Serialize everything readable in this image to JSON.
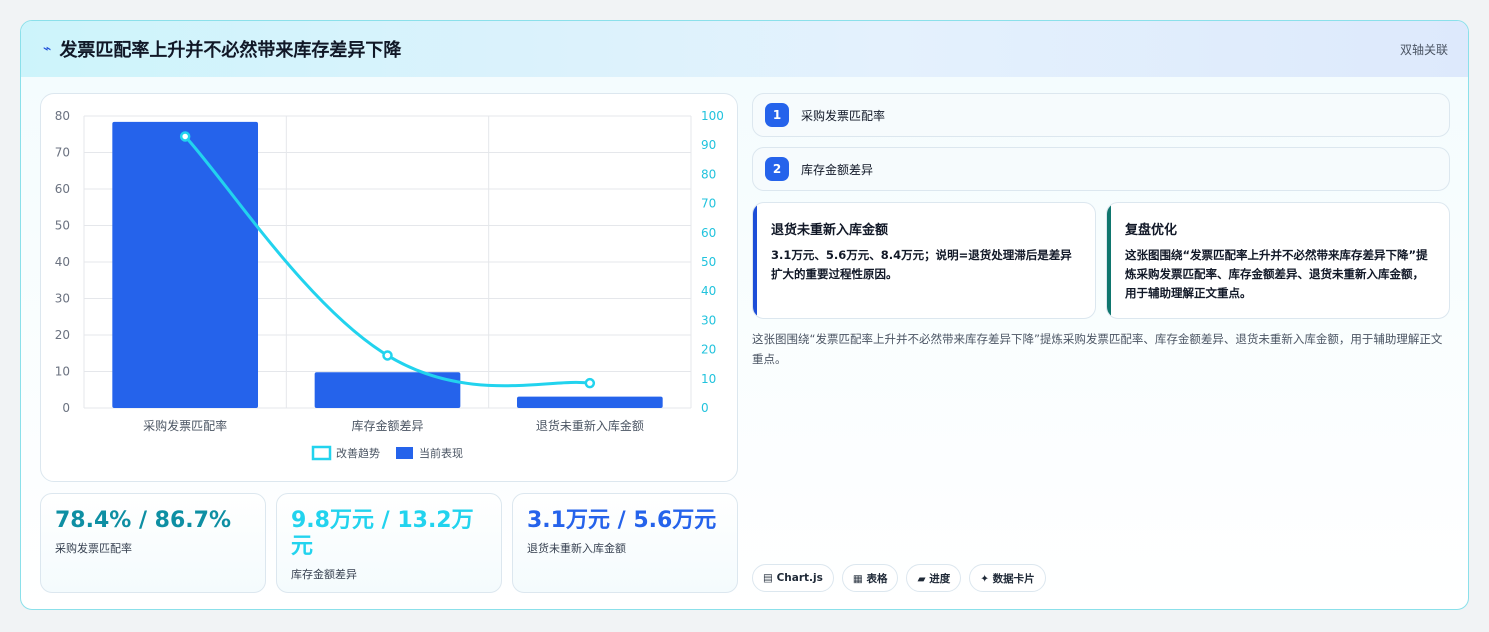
{
  "header": {
    "icon": "lightning-icon",
    "title": "发票匹配率上升并不必然带来库存差异下降",
    "tag": "双轴关联"
  },
  "chart_data": {
    "type": "bar",
    "categories": [
      "采购发票匹配率",
      "库存金额差异",
      "退货未重新入库金额"
    ],
    "series": [
      {
        "name": "当前表现",
        "type": "bar",
        "axis": "left",
        "values": [
          78.4,
          9.8,
          3.1
        ]
      },
      {
        "name": "改善趋势",
        "type": "line",
        "axis": "right",
        "values": [
          93,
          18,
          8.5
        ]
      }
    ],
    "ylim_left": [
      0,
      80
    ],
    "ylim_right": [
      0,
      100
    ],
    "yticks_left": [
      "0",
      "10",
      "20",
      "30",
      "40",
      "50",
      "60",
      "70",
      "80"
    ],
    "yticks_right": [
      "0",
      "10",
      "20",
      "30",
      "40",
      "50",
      "60",
      "70",
      "80",
      "90",
      "100"
    ],
    "legend": [
      "改善趋势",
      "当前表现"
    ],
    "legend_position": "bottom",
    "colors": {
      "bar": "#2563eb",
      "line": "#22d3ee",
      "right_axis": "#22c3dd"
    },
    "grid": true
  },
  "stats": [
    {
      "value": "78.4% / 86.7%",
      "label": "采购发票匹配率",
      "color": "#0e8fa3"
    },
    {
      "value": "9.8万元 / 13.2万元",
      "label": "库存金额差异",
      "color": "#22d3ee"
    },
    {
      "value": "3.1万元 / 5.6万元",
      "label": "退货未重新入库金额",
      "color": "#2563eb"
    }
  ],
  "items": [
    {
      "num": "1",
      "text": "采购发票匹配率"
    },
    {
      "num": "2",
      "text": "库存金额差异"
    }
  ],
  "notes": [
    {
      "title": "退货未重新入库金额",
      "text": "3.1万元、5.6万元、8.4万元；说明=退货处理滞后是差异扩大的重要过程性原因。"
    },
    {
      "title": "复盘优化",
      "text": "这张图围绕“发票匹配率上升并不必然带来库存差异下降”提炼采购发票匹配率、库存金额差异、退货未重新入库金额，用于辅助理解正文重点。"
    }
  ],
  "paragraph": "这张图围绕“发票匹配率上升并不必然带来库存差异下降”提炼采购发票匹配率、库存金额差异、退货未重新入库金额，用于辅助理解正文重点。",
  "pills": [
    "▤ Chart.js",
    "▦ 表格",
    "▰ 进度",
    "✦ 数据卡片"
  ]
}
